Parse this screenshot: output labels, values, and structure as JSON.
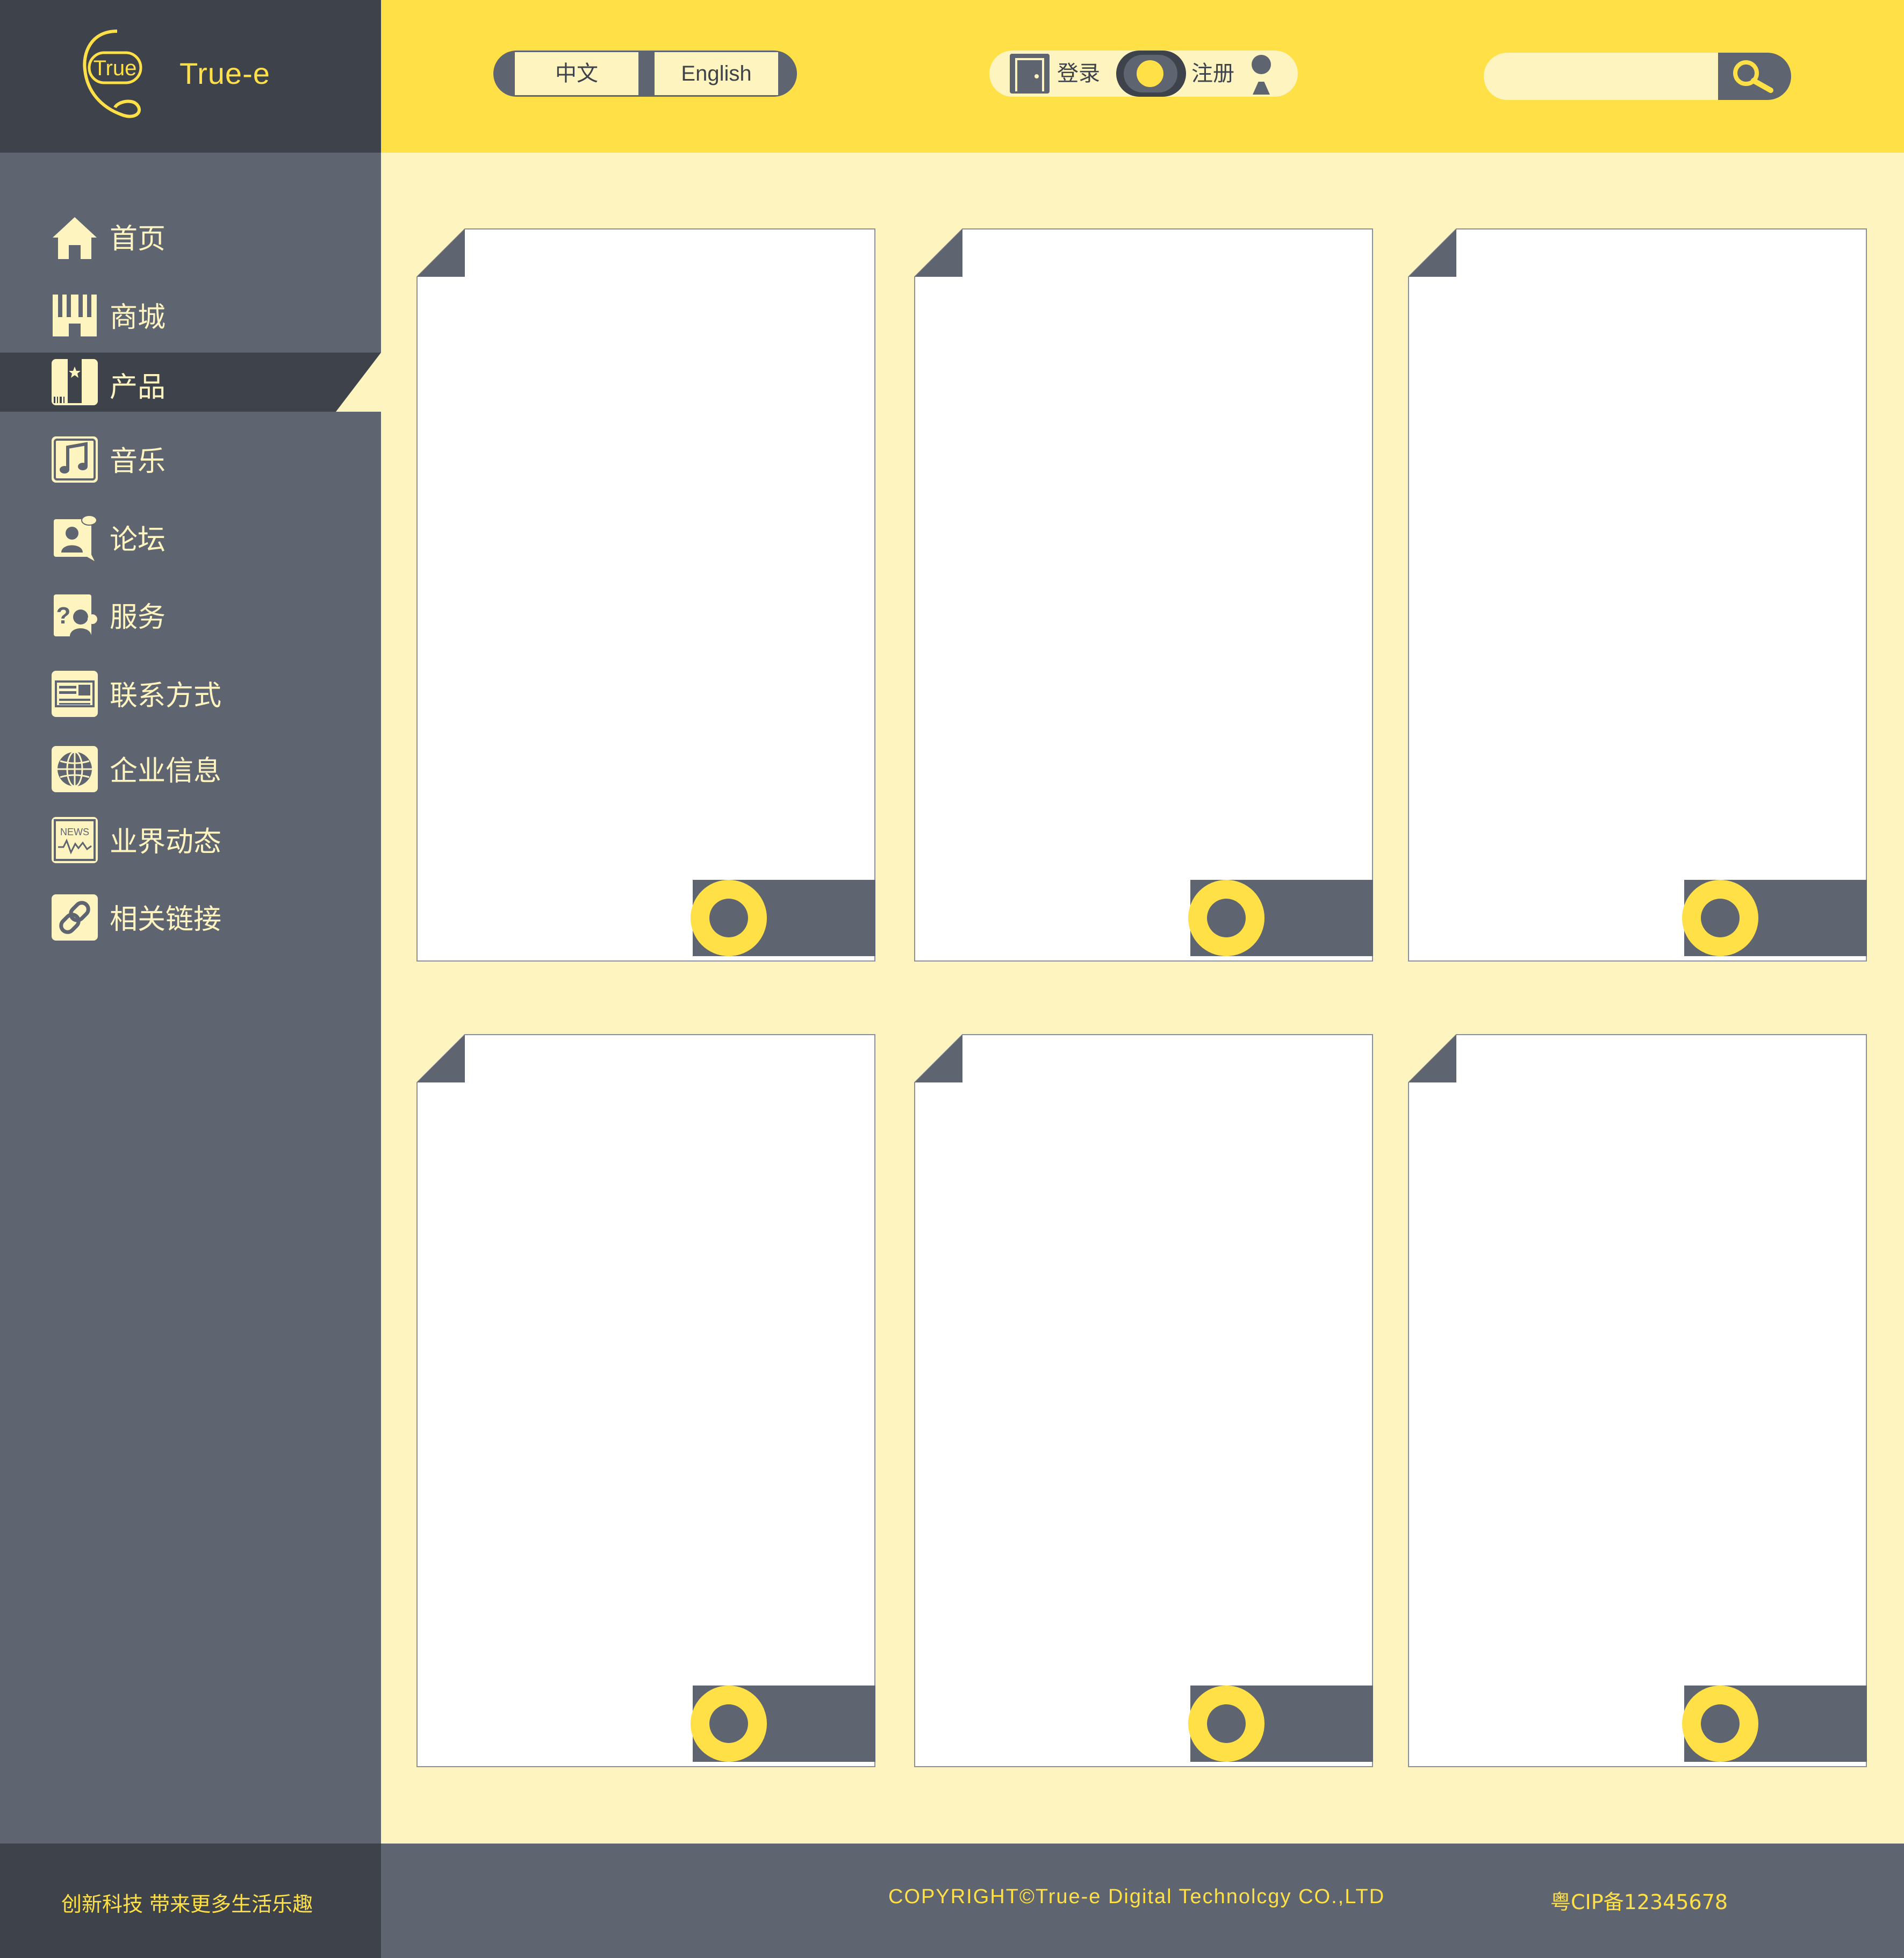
{
  "brand": {
    "name": "True-e",
    "logo_text": "True"
  },
  "header": {
    "languages": [
      "中文",
      "English"
    ],
    "auth": {
      "login_label": "登录",
      "register_label": "注册"
    },
    "search": {
      "placeholder": ""
    }
  },
  "sidebar": {
    "items": [
      {
        "label": "首页",
        "icon": "home-icon"
      },
      {
        "label": "商城",
        "icon": "store-icon"
      },
      {
        "label": "产品",
        "icon": "product-icon",
        "active": true
      },
      {
        "label": "音乐",
        "icon": "music-icon"
      },
      {
        "label": "论坛",
        "icon": "forum-icon"
      },
      {
        "label": "服务",
        "icon": "service-icon"
      },
      {
        "label": "联系方式",
        "icon": "contact-card-icon"
      },
      {
        "label": "企业信息",
        "icon": "globe-icon"
      },
      {
        "label": "业界动态",
        "icon": "news-icon"
      },
      {
        "label": "相关链接",
        "icon": "link-icon"
      }
    ],
    "news_icon_text": "NEWS"
  },
  "cards": {
    "count": 6
  },
  "footer": {
    "slogan": "创新科技  带来更多生活乐趣",
    "copyright": "COPYRIGHT©True-e Digital Technolcgy CO.,LTD",
    "icp": "粤CIP备12345678"
  },
  "colors": {
    "sidebar": "#5e6470",
    "sidebar_dark": "#3d424b",
    "accent_yellow": "#ffe046",
    "cream": "#fef4c0",
    "card_bg": "#ffffff"
  }
}
